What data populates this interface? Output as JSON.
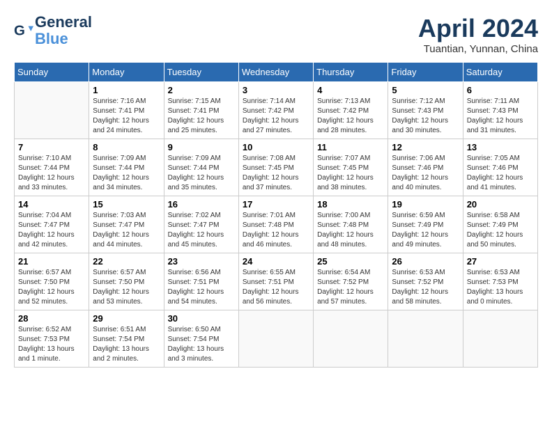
{
  "header": {
    "logo_line1": "General",
    "logo_line2": "Blue",
    "month": "April 2024",
    "location": "Tuantian, Yunnan, China"
  },
  "weekdays": [
    "Sunday",
    "Monday",
    "Tuesday",
    "Wednesday",
    "Thursday",
    "Friday",
    "Saturday"
  ],
  "weeks": [
    [
      {
        "day": "",
        "info": ""
      },
      {
        "day": "1",
        "info": "Sunrise: 7:16 AM\nSunset: 7:41 PM\nDaylight: 12 hours\nand 24 minutes."
      },
      {
        "day": "2",
        "info": "Sunrise: 7:15 AM\nSunset: 7:41 PM\nDaylight: 12 hours\nand 25 minutes."
      },
      {
        "day": "3",
        "info": "Sunrise: 7:14 AM\nSunset: 7:42 PM\nDaylight: 12 hours\nand 27 minutes."
      },
      {
        "day": "4",
        "info": "Sunrise: 7:13 AM\nSunset: 7:42 PM\nDaylight: 12 hours\nand 28 minutes."
      },
      {
        "day": "5",
        "info": "Sunrise: 7:12 AM\nSunset: 7:43 PM\nDaylight: 12 hours\nand 30 minutes."
      },
      {
        "day": "6",
        "info": "Sunrise: 7:11 AM\nSunset: 7:43 PM\nDaylight: 12 hours\nand 31 minutes."
      }
    ],
    [
      {
        "day": "7",
        "info": "Sunrise: 7:10 AM\nSunset: 7:44 PM\nDaylight: 12 hours\nand 33 minutes."
      },
      {
        "day": "8",
        "info": "Sunrise: 7:09 AM\nSunset: 7:44 PM\nDaylight: 12 hours\nand 34 minutes."
      },
      {
        "day": "9",
        "info": "Sunrise: 7:09 AM\nSunset: 7:44 PM\nDaylight: 12 hours\nand 35 minutes."
      },
      {
        "day": "10",
        "info": "Sunrise: 7:08 AM\nSunset: 7:45 PM\nDaylight: 12 hours\nand 37 minutes."
      },
      {
        "day": "11",
        "info": "Sunrise: 7:07 AM\nSunset: 7:45 PM\nDaylight: 12 hours\nand 38 minutes."
      },
      {
        "day": "12",
        "info": "Sunrise: 7:06 AM\nSunset: 7:46 PM\nDaylight: 12 hours\nand 40 minutes."
      },
      {
        "day": "13",
        "info": "Sunrise: 7:05 AM\nSunset: 7:46 PM\nDaylight: 12 hours\nand 41 minutes."
      }
    ],
    [
      {
        "day": "14",
        "info": "Sunrise: 7:04 AM\nSunset: 7:47 PM\nDaylight: 12 hours\nand 42 minutes."
      },
      {
        "day": "15",
        "info": "Sunrise: 7:03 AM\nSunset: 7:47 PM\nDaylight: 12 hours\nand 44 minutes."
      },
      {
        "day": "16",
        "info": "Sunrise: 7:02 AM\nSunset: 7:47 PM\nDaylight: 12 hours\nand 45 minutes."
      },
      {
        "day": "17",
        "info": "Sunrise: 7:01 AM\nSunset: 7:48 PM\nDaylight: 12 hours\nand 46 minutes."
      },
      {
        "day": "18",
        "info": "Sunrise: 7:00 AM\nSunset: 7:48 PM\nDaylight: 12 hours\nand 48 minutes."
      },
      {
        "day": "19",
        "info": "Sunrise: 6:59 AM\nSunset: 7:49 PM\nDaylight: 12 hours\nand 49 minutes."
      },
      {
        "day": "20",
        "info": "Sunrise: 6:58 AM\nSunset: 7:49 PM\nDaylight: 12 hours\nand 50 minutes."
      }
    ],
    [
      {
        "day": "21",
        "info": "Sunrise: 6:57 AM\nSunset: 7:50 PM\nDaylight: 12 hours\nand 52 minutes."
      },
      {
        "day": "22",
        "info": "Sunrise: 6:57 AM\nSunset: 7:50 PM\nDaylight: 12 hours\nand 53 minutes."
      },
      {
        "day": "23",
        "info": "Sunrise: 6:56 AM\nSunset: 7:51 PM\nDaylight: 12 hours\nand 54 minutes."
      },
      {
        "day": "24",
        "info": "Sunrise: 6:55 AM\nSunset: 7:51 PM\nDaylight: 12 hours\nand 56 minutes."
      },
      {
        "day": "25",
        "info": "Sunrise: 6:54 AM\nSunset: 7:52 PM\nDaylight: 12 hours\nand 57 minutes."
      },
      {
        "day": "26",
        "info": "Sunrise: 6:53 AM\nSunset: 7:52 PM\nDaylight: 12 hours\nand 58 minutes."
      },
      {
        "day": "27",
        "info": "Sunrise: 6:53 AM\nSunset: 7:53 PM\nDaylight: 13 hours\nand 0 minutes."
      }
    ],
    [
      {
        "day": "28",
        "info": "Sunrise: 6:52 AM\nSunset: 7:53 PM\nDaylight: 13 hours\nand 1 minute."
      },
      {
        "day": "29",
        "info": "Sunrise: 6:51 AM\nSunset: 7:54 PM\nDaylight: 13 hours\nand 2 minutes."
      },
      {
        "day": "30",
        "info": "Sunrise: 6:50 AM\nSunset: 7:54 PM\nDaylight: 13 hours\nand 3 minutes."
      },
      {
        "day": "",
        "info": ""
      },
      {
        "day": "",
        "info": ""
      },
      {
        "day": "",
        "info": ""
      },
      {
        "day": "",
        "info": ""
      }
    ]
  ]
}
